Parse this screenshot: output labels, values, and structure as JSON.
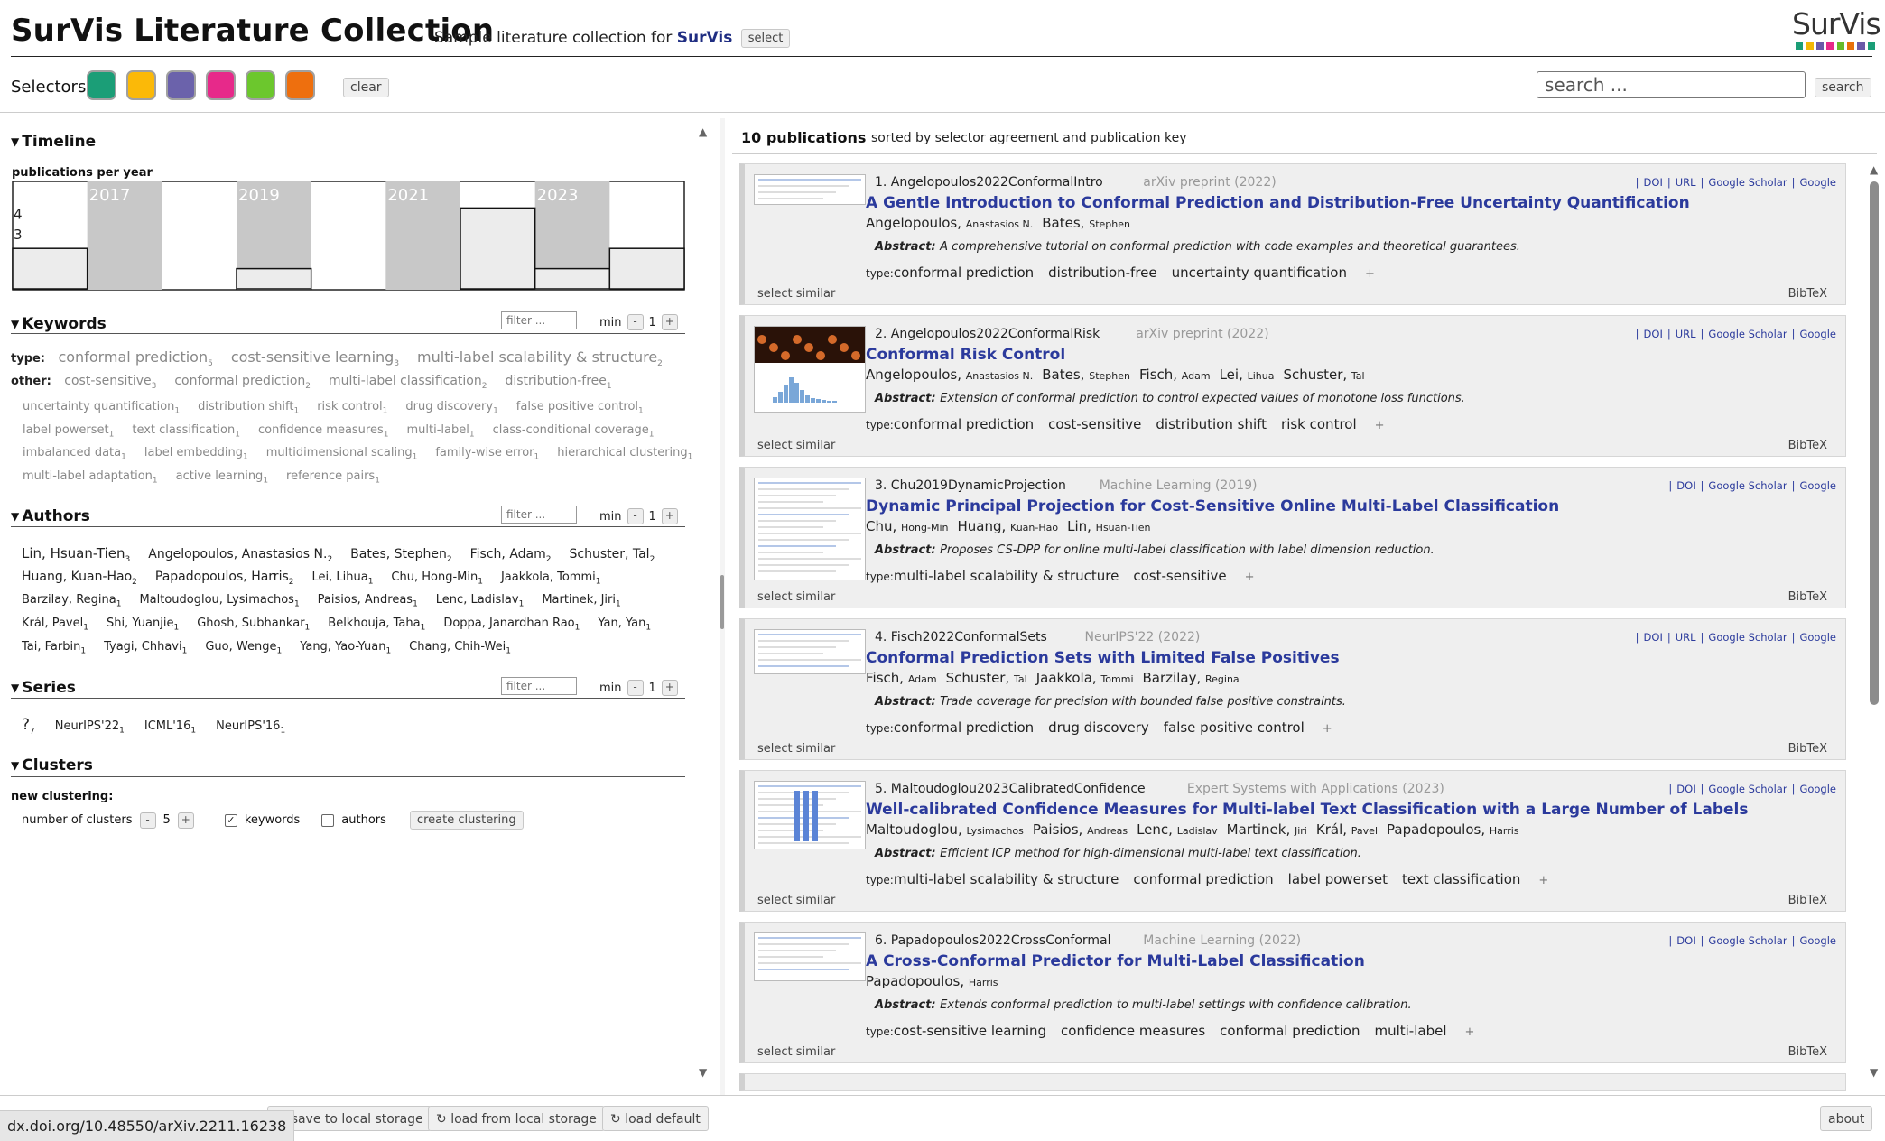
{
  "header": {
    "title": "SurVis Literature Collection",
    "subtitle_prefix": "Sample literature collection for",
    "subtitle_brand": "SurVis",
    "select_label": "select",
    "logo_text": "SurVis",
    "logo_colors": [
      "#1b9e77",
      "#f2b705",
      "#6a5aa8",
      "#e7298a",
      "#66bb2a",
      "#e8710a",
      "#6a5aa8",
      "#1b9e77"
    ]
  },
  "selectors": {
    "label": "Selectors",
    "colors": [
      "#1b9e77",
      "#fbb908",
      "#6b62ab",
      "#e7298a",
      "#6cc72d",
      "#ee6f0e"
    ],
    "clear_label": "clear"
  },
  "search": {
    "placeholder": "search ...",
    "button_label": "search"
  },
  "timeline": {
    "title": "Timeline",
    "subtitle": "publications per year",
    "years": [
      "2016",
      "2017",
      "2018",
      "2019",
      "2020",
      "2021",
      "2022",
      "2023",
      "2024"
    ],
    "counts": [
      2,
      0,
      0,
      1,
      0,
      0,
      4,
      1,
      2
    ],
    "shaded_years": [
      "2017",
      "2019",
      "2021",
      "2023"
    ],
    "axis_labels": [
      "4",
      "3"
    ]
  },
  "keywords": {
    "title": "Keywords",
    "filter_placeholder": "filter ...",
    "min_label": "min",
    "min_value": "1",
    "type_label": "type:",
    "other_label": "other:",
    "type": [
      {
        "name": "conformal prediction",
        "count": "5"
      },
      {
        "name": "cost-sensitive learning",
        "count": "3"
      },
      {
        "name": "multi-label scalability & structure",
        "count": "2"
      }
    ],
    "other_row1": [
      {
        "name": "cost-sensitive",
        "count": "3"
      },
      {
        "name": "conformal prediction",
        "count": "2"
      },
      {
        "name": "multi-label classification",
        "count": "2"
      },
      {
        "name": "distribution-free",
        "count": "1"
      }
    ],
    "row2": [
      {
        "name": "uncertainty quantification",
        "count": "1"
      },
      {
        "name": "distribution shift",
        "count": "1"
      },
      {
        "name": "risk control",
        "count": "1"
      },
      {
        "name": "drug discovery",
        "count": "1"
      },
      {
        "name": "false positive control",
        "count": "1"
      }
    ],
    "row3": [
      {
        "name": "label powerset",
        "count": "1"
      },
      {
        "name": "text classification",
        "count": "1"
      },
      {
        "name": "confidence measures",
        "count": "1"
      },
      {
        "name": "multi-label",
        "count": "1"
      },
      {
        "name": "class-conditional coverage",
        "count": "1"
      }
    ],
    "row4": [
      {
        "name": "imbalanced data",
        "count": "1"
      },
      {
        "name": "label embedding",
        "count": "1"
      },
      {
        "name": "multidimensional scaling",
        "count": "1"
      },
      {
        "name": "family-wise error",
        "count": "1"
      },
      {
        "name": "hierarchical clustering",
        "count": "1"
      }
    ],
    "row5": [
      {
        "name": "multi-label adaptation",
        "count": "1"
      },
      {
        "name": "active learning",
        "count": "1"
      },
      {
        "name": "reference pairs",
        "count": "1"
      }
    ]
  },
  "authors": {
    "title": "Authors",
    "filter_placeholder": "filter ...",
    "min_label": "min",
    "min_value": "1",
    "rows": [
      [
        {
          "name": "Lin, Hsuan-Tien",
          "count": "3"
        },
        {
          "name": "Angelopoulos, Anastasios N.",
          "count": "2"
        },
        {
          "name": "Bates, Stephen",
          "count": "2"
        },
        {
          "name": "Fisch, Adam",
          "count": "2"
        },
        {
          "name": "Schuster, Tal",
          "count": "2"
        }
      ],
      [
        {
          "name": "Huang, Kuan-Hao",
          "count": "2"
        },
        {
          "name": "Papadopoulos, Harris",
          "count": "2"
        },
        {
          "name": "Lei, Lihua",
          "count": "1"
        },
        {
          "name": "Chu, Hong-Min",
          "count": "1"
        },
        {
          "name": "Jaakkola, Tommi",
          "count": "1"
        }
      ],
      [
        {
          "name": "Barzilay, Regina",
          "count": "1"
        },
        {
          "name": "Maltoudoglou, Lysimachos",
          "count": "1"
        },
        {
          "name": "Paisios, Andreas",
          "count": "1"
        },
        {
          "name": "Lenc, Ladislav",
          "count": "1"
        },
        {
          "name": "Martinek, Jiri",
          "count": "1"
        }
      ],
      [
        {
          "name": "Král, Pavel",
          "count": "1"
        },
        {
          "name": "Shi, Yuanjie",
          "count": "1"
        },
        {
          "name": "Ghosh, Subhankar",
          "count": "1"
        },
        {
          "name": "Belkhouja, Taha",
          "count": "1"
        },
        {
          "name": "Doppa, Janardhan Rao",
          "count": "1"
        },
        {
          "name": "Yan, Yan",
          "count": "1"
        }
      ],
      [
        {
          "name": "Tai, Farbin",
          "count": "1"
        },
        {
          "name": "Tyagi, Chhavi",
          "count": "1"
        },
        {
          "name": "Guo, Wenge",
          "count": "1"
        },
        {
          "name": "Yang, Yao-Yuan",
          "count": "1"
        },
        {
          "name": "Chang, Chih-Wei",
          "count": "1"
        }
      ]
    ]
  },
  "series": {
    "title": "Series",
    "filter_placeholder": "filter ...",
    "min_label": "min",
    "min_value": "1",
    "items": [
      {
        "name": "?",
        "count": "7"
      },
      {
        "name": "NeurIPS'22",
        "count": "1"
      },
      {
        "name": "ICML'16",
        "count": "1"
      },
      {
        "name": "NeurIPS'16",
        "count": "1"
      }
    ]
  },
  "clusters": {
    "title": "Clusters",
    "new_label": "new clustering:",
    "number_label": "number of clusters",
    "number_value": "5",
    "keywords_label": "keywords",
    "authors_label": "authors",
    "create_label": "create clustering"
  },
  "publications": {
    "count_label": "10 publications",
    "sort_label": "sorted by selector agreement and publication key",
    "select_similar": "select similar",
    "bibtex": "BibTeX",
    "abstract_label": "Abstract:",
    "type_label": "type:",
    "entries": [
      {
        "index": "1.",
        "key": "Angelopoulos2022ConformalIntro",
        "venue": "arXiv preprint",
        "year": "(2022)",
        "title": "A Gentle Introduction to Conformal Prediction and Distribution-Free Uncertainty Quantification",
        "authors": [
          {
            "last": "Angelopoulos",
            "first": "Anastasios N."
          },
          {
            "last": "Bates",
            "first": "Stephen"
          }
        ],
        "abstract": "A comprehensive tutorial on conformal prediction with code examples and theoretical guarantees.",
        "keywords": [
          "conformal prediction",
          "distribution-free",
          "uncertainty quantification"
        ],
        "links": [
          "DOI",
          "URL",
          "Google Scholar",
          "Google"
        ]
      },
      {
        "index": "2.",
        "key": "Angelopoulos2022ConformalRisk",
        "venue": "arXiv preprint",
        "year": "(2022)",
        "title": "Conformal Risk Control",
        "authors": [
          {
            "last": "Angelopoulos",
            "first": "Anastasios N."
          },
          {
            "last": "Bates",
            "first": "Stephen"
          },
          {
            "last": "Fisch",
            "first": "Adam"
          },
          {
            "last": "Lei",
            "first": "Lihua"
          },
          {
            "last": "Schuster",
            "first": "Tal"
          }
        ],
        "abstract": "Extension of conformal prediction to control expected values of monotone loss functions.",
        "keywords": [
          "conformal prediction",
          "cost-sensitive",
          "distribution shift",
          "risk control"
        ],
        "links": [
          "DOI",
          "URL",
          "Google Scholar",
          "Google"
        ]
      },
      {
        "index": "3.",
        "key": "Chu2019DynamicProjection",
        "venue": "Machine Learning",
        "year": "(2019)",
        "title": "Dynamic Principal Projection for Cost-Sensitive Online Multi-Label Classification",
        "authors": [
          {
            "last": "Chu",
            "first": "Hong-Min"
          },
          {
            "last": "Huang",
            "first": "Kuan-Hao"
          },
          {
            "last": "Lin",
            "first": "Hsuan-Tien"
          }
        ],
        "abstract": "Proposes CS-DPP for online multi-label classification with label dimension reduction.",
        "keywords": [
          "multi-label scalability & structure",
          "cost-sensitive"
        ],
        "links": [
          "DOI",
          "Google Scholar",
          "Google"
        ]
      },
      {
        "index": "4.",
        "key": "Fisch2022ConformalSets",
        "venue": "NeurIPS'22",
        "year": "(2022)",
        "title": "Conformal Prediction Sets with Limited False Positives",
        "authors": [
          {
            "last": "Fisch",
            "first": "Adam"
          },
          {
            "last": "Schuster",
            "first": "Tal"
          },
          {
            "last": "Jaakkola",
            "first": "Tommi"
          },
          {
            "last": "Barzilay",
            "first": "Regina"
          }
        ],
        "abstract": "Trade coverage for precision with bounded false positive constraints.",
        "keywords": [
          "conformal prediction",
          "drug discovery",
          "false positive control"
        ],
        "links": [
          "DOI",
          "URL",
          "Google Scholar",
          "Google"
        ]
      },
      {
        "index": "5.",
        "key": "Maltoudoglou2023CalibratedConfidence",
        "venue": "Expert Systems with Applications",
        "year": "(2023)",
        "title": "Well-calibrated Confidence Measures for Multi-label Text Classification with a Large Number of Labels",
        "authors": [
          {
            "last": "Maltoudoglou",
            "first": "Lysimachos"
          },
          {
            "last": "Paisios",
            "first": "Andreas"
          },
          {
            "last": "Lenc",
            "first": "Ladislav"
          },
          {
            "last": "Martinek",
            "first": "Jiri"
          },
          {
            "last": "Král",
            "first": "Pavel"
          },
          {
            "last": "Papadopoulos",
            "first": "Harris"
          }
        ],
        "abstract": "Efficient ICP method for high-dimensional multi-label text classification.",
        "keywords": [
          "multi-label scalability & structure",
          "conformal prediction",
          "label powerset",
          "text classification"
        ],
        "links": [
          "DOI",
          "Google Scholar",
          "Google"
        ]
      },
      {
        "index": "6.",
        "key": "Papadopoulos2022CrossConformal",
        "venue": "Machine Learning",
        "year": "(2022)",
        "title": "A Cross-Conformal Predictor for Multi-Label Classification",
        "authors": [
          {
            "last": "Papadopoulos",
            "first": "Harris"
          }
        ],
        "abstract": "Extends conformal prediction to multi-label settings with confidence calibration.",
        "keywords": [
          "cost-sensitive learning",
          "confidence measures",
          "conformal prediction",
          "multi-label"
        ],
        "links": [
          "DOI",
          "Google Scholar",
          "Google"
        ]
      }
    ]
  },
  "footer": {
    "save_label": "save to local storage",
    "load_label": "load from local storage",
    "default_label": "load default",
    "about_label": "about",
    "status_url": "dx.doi.org/10.48550/arXiv.2211.16238"
  }
}
